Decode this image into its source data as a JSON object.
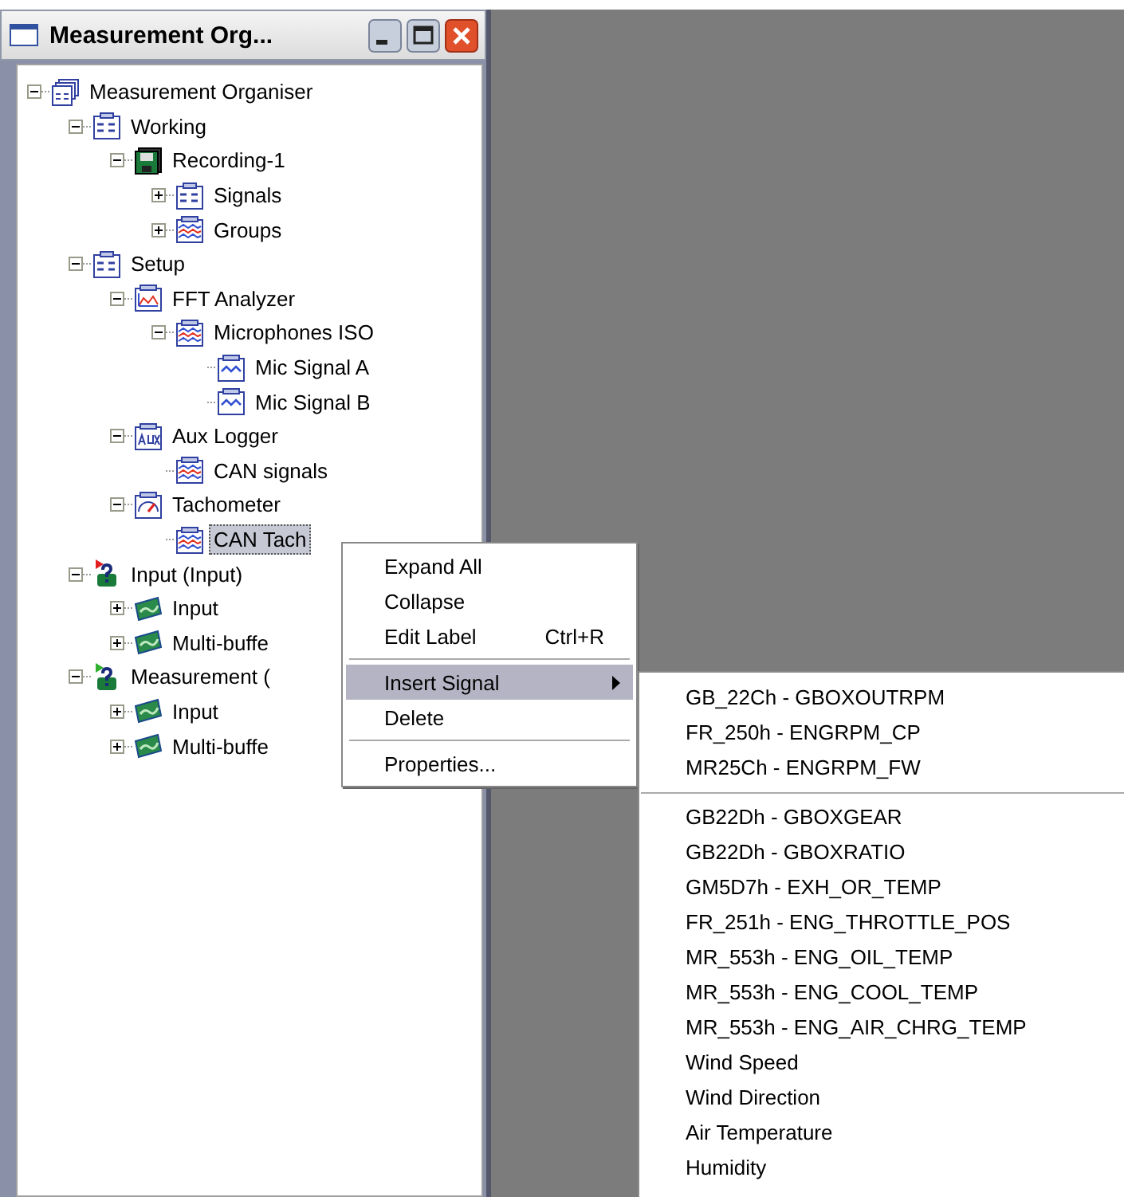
{
  "window": {
    "title": "Measurement Org..."
  },
  "tree": [
    {
      "label": "Measurement Organiser",
      "kind": "organiser",
      "expanded": true,
      "selected": false,
      "children": [
        {
          "label": "Working",
          "kind": "folder",
          "expanded": true,
          "selected": false,
          "children": [
            {
              "label": "Recording-1",
              "kind": "recorder",
              "expanded": true,
              "selected": false,
              "children": [
                {
                  "label": "Signals",
                  "kind": "folder",
                  "expanded": false,
                  "selected": false
                },
                {
                  "label": "Groups",
                  "kind": "group",
                  "expanded": false,
                  "selected": false
                }
              ]
            }
          ]
        },
        {
          "label": "Setup",
          "kind": "folder",
          "expanded": true,
          "selected": false,
          "children": [
            {
              "label": "FFT Analyzer",
              "kind": "analyzer",
              "expanded": true,
              "selected": false,
              "children": [
                {
                  "label": "Microphones ISO",
                  "kind": "group",
                  "expanded": true,
                  "selected": false,
                  "children": [
                    {
                      "label": "Mic Signal A",
                      "kind": "signal",
                      "selected": false
                    },
                    {
                      "label": "Mic Signal B",
                      "kind": "signal",
                      "selected": false
                    }
                  ]
                }
              ]
            },
            {
              "label": "Aux Logger",
              "kind": "aux",
              "expanded": true,
              "selected": false,
              "children": [
                {
                  "label": "CAN signals",
                  "kind": "group",
                  "selected": false
                }
              ]
            },
            {
              "label": "Tachometer",
              "kind": "tachometer",
              "expanded": true,
              "selected": false,
              "children": [
                {
                  "label": "CAN Tach",
                  "kind": "group",
                  "selected": true
                }
              ]
            }
          ]
        },
        {
          "label": "Input (Input)",
          "kind": "source",
          "color": "#e02020",
          "expanded": true,
          "selected": false,
          "children": [
            {
              "label": "Input",
              "kind": "stream",
              "expanded": false,
              "selected": false
            },
            {
              "label": "Multi-buffe",
              "kind": "stream",
              "expanded": false,
              "selected": false
            }
          ]
        },
        {
          "label": "Measurement (",
          "kind": "source",
          "color": "#30b030",
          "expanded": true,
          "selected": false,
          "children": [
            {
              "label": "Input",
              "kind": "stream",
              "expanded": false,
              "selected": false
            },
            {
              "label": "Multi-buffe",
              "kind": "stream",
              "expanded": false,
              "selected": false
            }
          ]
        }
      ]
    }
  ],
  "context_menu": [
    {
      "kind": "item",
      "label": "Expand All",
      "selected": false
    },
    {
      "kind": "item",
      "label": "Collapse",
      "selected": false
    },
    {
      "kind": "item",
      "label": "Edit Label",
      "shortcut": "Ctrl+R",
      "selected": false
    },
    {
      "kind": "separator"
    },
    {
      "kind": "submenu",
      "label": "Insert Signal",
      "selected": true
    },
    {
      "kind": "item",
      "label": "Delete",
      "selected": false
    },
    {
      "kind": "separator"
    },
    {
      "kind": "item",
      "label": "Properties...",
      "selected": false
    }
  ],
  "submenu": [
    {
      "kind": "item",
      "label": "GB_22Ch - GBOXOUTRPM"
    },
    {
      "kind": "item",
      "label": "FR_250h - ENGRPM_CP"
    },
    {
      "kind": "item",
      "label": "MR25Ch - ENGRPM_FW"
    },
    {
      "kind": "separator"
    },
    {
      "kind": "item",
      "label": "GB22Dh - GBOXGEAR"
    },
    {
      "kind": "item",
      "label": "GB22Dh - GBOXRATIO"
    },
    {
      "kind": "item",
      "label": "GM5D7h - EXH_OR_TEMP"
    },
    {
      "kind": "item",
      "label": "FR_251h - ENG_THROTTLE_POS"
    },
    {
      "kind": "item",
      "label": "MR_553h - ENG_OIL_TEMP"
    },
    {
      "kind": "item",
      "label": "MR_553h - ENG_COOL_TEMP"
    },
    {
      "kind": "item",
      "label": "MR_553h - ENG_AIR_CHRG_TEMP"
    },
    {
      "kind": "item",
      "label": "Wind Speed"
    },
    {
      "kind": "item",
      "label": "Wind Direction"
    },
    {
      "kind": "item",
      "label": "Air Temperature"
    },
    {
      "kind": "item",
      "label": "Humidity"
    }
  ]
}
